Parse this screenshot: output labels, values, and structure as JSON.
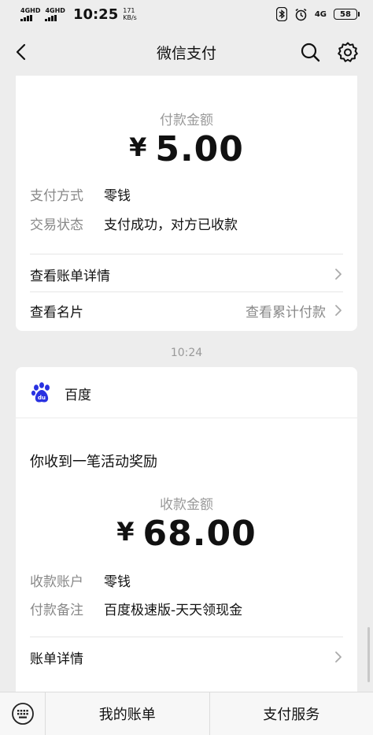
{
  "status_bar": {
    "sim1_label": "4GHD",
    "sim2_label": "4GHD",
    "time": "10:25",
    "speed_value": "171",
    "speed_unit": "KB/s",
    "net_label": "4G",
    "battery": "58"
  },
  "nav": {
    "title": "微信支付",
    "back_icon": "chevron-left-icon",
    "search_icon": "search-icon",
    "settings_icon": "gear-icon"
  },
  "payment_card": {
    "amount_label": "付款金额",
    "currency_symbol": "¥",
    "amount": "5.00",
    "rows": [
      {
        "label": "支付方式",
        "value": "零钱"
      },
      {
        "label": "交易状态",
        "value": "支付成功，对方已收款"
      }
    ],
    "link_bill_detail": "查看账单详情",
    "link_card": "查看名片",
    "link_cumulative": "查看累计付款"
  },
  "timestamp": "10:24",
  "receipt_card": {
    "app_name": "百度",
    "logo_text": "du",
    "notice": "你收到一笔活动奖励",
    "amount_label": "收款金额",
    "currency_symbol": "¥",
    "amount": "68.00",
    "rows": [
      {
        "label": "收款账户",
        "value": "零钱"
      },
      {
        "label": "付款备注",
        "value": "百度极速版-天天领现金"
      }
    ],
    "link_bill_detail": "账单详情"
  },
  "bottom_bar": {
    "keyboard_icon": "keyboard-icon",
    "my_bill": "我的账单",
    "pay_service": "支付服务"
  },
  "colors": {
    "background": "#ededed",
    "card": "#ffffff",
    "muted_text": "#999999",
    "primary_text": "#111111",
    "baidu_blue": "#2932e1"
  }
}
